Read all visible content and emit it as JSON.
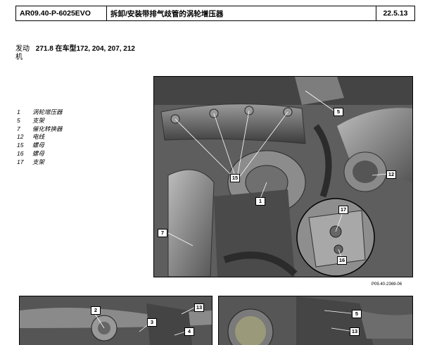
{
  "header": {
    "code": "AR09.40-P-6025EVO",
    "title": "拆卸/安装带排气歧管的涡轮增压器",
    "date": "22.5.13"
  },
  "engine": {
    "label": "发动机",
    "label_top": "发动",
    "label_bottom": "机",
    "text": "271.8 在车型172, 204, 207, 212"
  },
  "legend": [
    {
      "num": "1",
      "text": "涡轮增压器"
    },
    {
      "num": "5",
      "text": "支架"
    },
    {
      "num": "7",
      "text": "催化转换器"
    },
    {
      "num": "12",
      "text": "电线"
    },
    {
      "num": "15",
      "text": "螺母"
    },
    {
      "num": "16",
      "text": "螺母"
    },
    {
      "num": "17",
      "text": "支架"
    }
  ],
  "figure_main": {
    "callouts": [
      "5",
      "15",
      "1",
      "12",
      "7",
      "17",
      "16"
    ],
    "ref": "P09.40-2369-06"
  },
  "figure_left": {
    "callouts": [
      "2",
      "3",
      "13",
      "4"
    ]
  },
  "figure_right": {
    "callouts": [
      "5",
      "13"
    ]
  }
}
